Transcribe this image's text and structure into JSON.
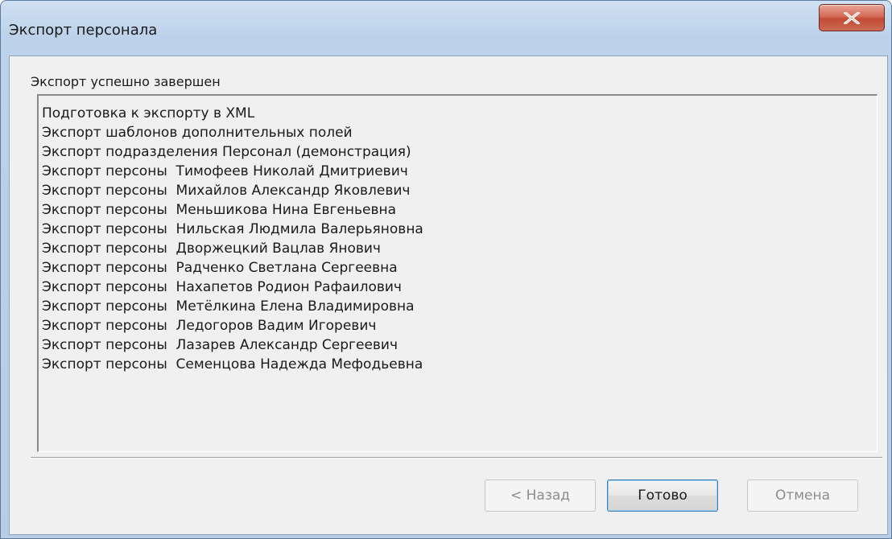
{
  "window": {
    "title": "Экспорт персонала",
    "close_label": "X"
  },
  "status": "Экспорт успешно завершен",
  "log": [
    "Подготовка к экспорту в XML",
    "Экспорт шаблонов дополнительных полей",
    "Экспорт подразделения Персонал (демонстрация)",
    "Экспорт персоны  Тимофеев Николай Дмитриевич",
    "Экспорт персоны  Михайлов Александр Яковлевич",
    "Экспорт персоны  Меньшикова Нина Евгеньевна",
    "Экспорт персоны  Нильская Людмила Валерьяновна",
    "Экспорт персоны  Дворжецкий Вацлав Янович",
    "Экспорт персоны  Радченко Светлана Сергеевна",
    "Экспорт персоны  Нахапетов Родион Рафаилович",
    "Экспорт персоны  Метёлкина Елена Владимировна",
    "Экспорт персоны  Ледогоров Вадим Игоревич",
    "Экспорт персоны  Лазарев Александр Сергеевич",
    "Экспорт персоны  Семенцова Надежда Мефодьевна"
  ],
  "buttons": {
    "back": "< Назад",
    "finish": "Готово",
    "cancel": "Отмена"
  }
}
